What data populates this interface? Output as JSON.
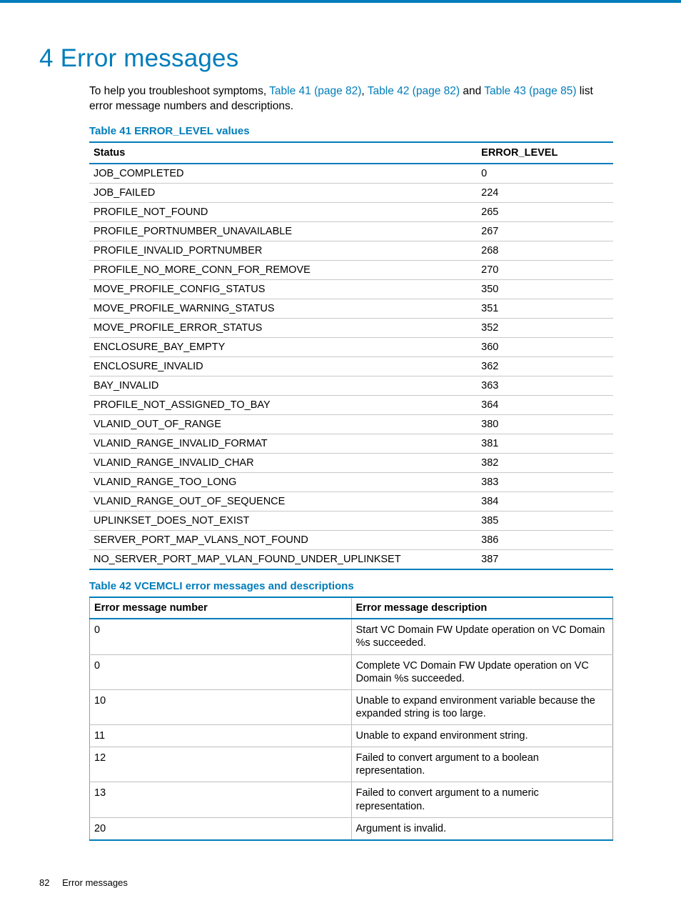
{
  "heading": "4 Error messages",
  "intro": {
    "pre": "To help you troubleshoot symptoms, ",
    "link1": "Table 41 (page 82)",
    "sep1": ", ",
    "link2": "Table 42 (page 82)",
    "sep2": " and ",
    "link3": "Table 43 (page 85)",
    "post": " list error message numbers and descriptions."
  },
  "table41": {
    "caption": "Table 41 ERROR_LEVEL values",
    "headers": {
      "status": "Status",
      "level": "ERROR_LEVEL"
    },
    "rows": [
      {
        "status": "JOB_COMPLETED",
        "level": "0"
      },
      {
        "status": "JOB_FAILED",
        "level": "224"
      },
      {
        "status": "PROFILE_NOT_FOUND",
        "level": "265"
      },
      {
        "status": "PROFILE_PORTNUMBER_UNAVAILABLE",
        "level": "267"
      },
      {
        "status": "PROFILE_INVALID_PORTNUMBER",
        "level": "268"
      },
      {
        "status": "PROFILE_NO_MORE_CONN_FOR_REMOVE",
        "level": "270"
      },
      {
        "status": "MOVE_PROFILE_CONFIG_STATUS",
        "level": "350"
      },
      {
        "status": "MOVE_PROFILE_WARNING_STATUS",
        "level": "351"
      },
      {
        "status": "MOVE_PROFILE_ERROR_STATUS",
        "level": "352"
      },
      {
        "status": "ENCLOSURE_BAY_EMPTY",
        "level": "360"
      },
      {
        "status": "ENCLOSURE_INVALID",
        "level": "362"
      },
      {
        "status": "BAY_INVALID",
        "level": "363"
      },
      {
        "status": "PROFILE_NOT_ASSIGNED_TO_BAY",
        "level": "364"
      },
      {
        "status": "VLANID_OUT_OF_RANGE",
        "level": "380"
      },
      {
        "status": "VLANID_RANGE_INVALID_FORMAT",
        "level": "381"
      },
      {
        "status": "VLANID_RANGE_INVALID_CHAR",
        "level": "382"
      },
      {
        "status": "VLANID_RANGE_TOO_LONG",
        "level": "383"
      },
      {
        "status": "VLANID_RANGE_OUT_OF_SEQUENCE",
        "level": "384"
      },
      {
        "status": "UPLINKSET_DOES_NOT_EXIST",
        "level": "385"
      },
      {
        "status": "SERVER_PORT_MAP_VLANS_NOT_FOUND",
        "level": "386"
      },
      {
        "status": "NO_SERVER_PORT_MAP_VLAN_FOUND_UNDER_UPLINKSET",
        "level": "387"
      }
    ]
  },
  "table42": {
    "caption": "Table 42 VCEMCLI error messages and descriptions",
    "headers": {
      "num": "Error message number",
      "desc": "Error message description"
    },
    "rows": [
      {
        "num": "0",
        "desc": "Start VC Domain FW Update operation on VC Domain %s succeeded."
      },
      {
        "num": "0",
        "desc": "Complete VC Domain FW Update operation on VC Domain %s succeeded."
      },
      {
        "num": "10",
        "desc": "Unable to expand environment variable because the expanded string is too large."
      },
      {
        "num": "11",
        "desc": "Unable to expand environment string."
      },
      {
        "num": "12",
        "desc": "Failed to convert argument to a boolean representation."
      },
      {
        "num": "13",
        "desc": "Failed to convert argument to a numeric representation."
      },
      {
        "num": "20",
        "desc": "Argument is invalid."
      }
    ]
  },
  "footer": {
    "page": "82",
    "title": "Error messages"
  }
}
